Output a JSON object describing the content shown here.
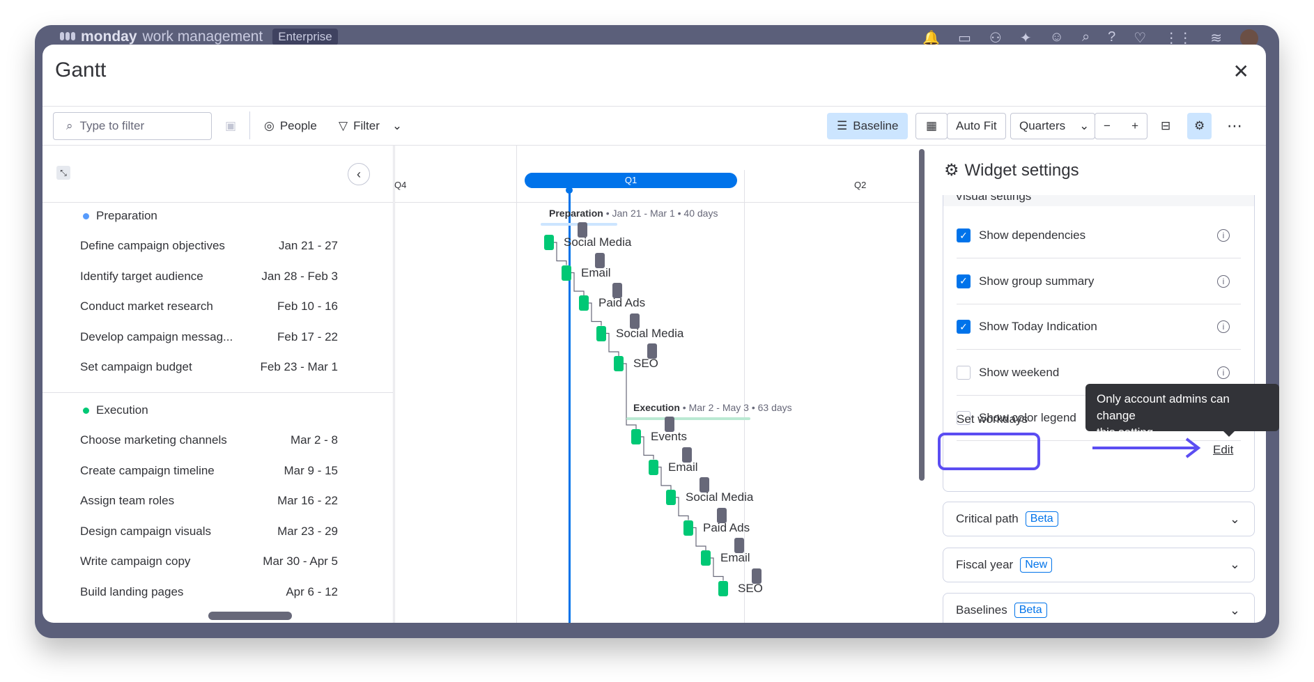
{
  "app": {
    "brand_bold": "monday",
    "brand_rest": "work management",
    "plan": "Enterprise"
  },
  "modal": {
    "title": "Gantt",
    "close": "✕"
  },
  "toolbar": {
    "filter_placeholder": "Type to filter",
    "people": "People",
    "filter": "Filter",
    "baseline": "Baseline",
    "auto_fit": "Auto Fit",
    "zoom": "Quarters"
  },
  "timeline": {
    "quarters": [
      "Q4",
      "Q1",
      "Q2"
    ]
  },
  "groups": [
    {
      "name": "Preparation",
      "color": "#579bfc",
      "summary_name": "Preparation",
      "summary_detail": " • Jan 21 - Mar 1 • 40 days",
      "tasks": [
        {
          "name": "Define campaign objectives",
          "dates": "Jan 21 - 27",
          "label": "Social Media"
        },
        {
          "name": "Identify target audience",
          "dates": "Jan 28 - Feb 3",
          "label": "Email"
        },
        {
          "name": "Conduct market research",
          "dates": "Feb 10 - 16",
          "label": "Paid Ads"
        },
        {
          "name": "Develop campaign messag...",
          "dates": "Feb 17 - 22",
          "label": "Social Media"
        },
        {
          "name": "Set campaign budget",
          "dates": "Feb 23 - Mar 1",
          "label": "SEO"
        }
      ]
    },
    {
      "name": "Execution",
      "color": "#00c875",
      "summary_name": "Execution",
      "summary_detail": " • Mar 2 - May 3 • 63 days",
      "tasks": [
        {
          "name": "Choose marketing channels",
          "dates": "Mar 2 - 8",
          "label": "Events"
        },
        {
          "name": "Create campaign timeline",
          "dates": "Mar 9 - 15",
          "label": "Email"
        },
        {
          "name": "Assign team roles",
          "dates": "Mar 16 - 22",
          "label": "Social Media"
        },
        {
          "name": "Design campaign visuals",
          "dates": "Mar 23 - 29",
          "label": "Paid Ads"
        },
        {
          "name": "Write campaign copy",
          "dates": "Mar 30 - Apr 5",
          "label": "Email"
        },
        {
          "name": "Build landing pages",
          "dates": "Apr 6 - 12",
          "label": "SEO"
        }
      ]
    }
  ],
  "settings": {
    "title": "Widget settings",
    "section": "Visual settings",
    "items": [
      {
        "label": "Show dependencies",
        "checked": true
      },
      {
        "label": "Show group summary",
        "checked": true
      },
      {
        "label": "Show Today Indication",
        "checked": true
      },
      {
        "label": "Show weekend",
        "checked": false
      },
      {
        "label": "Show color legend",
        "checked": false
      }
    ],
    "workdays_label": "Set workdays",
    "workdays_edit": "Edit",
    "accordions": [
      {
        "label": "Critical path",
        "badge": "Beta"
      },
      {
        "label": "Fiscal year",
        "badge": "New"
      },
      {
        "label": "Baselines",
        "badge": "Beta"
      }
    ]
  },
  "tooltip": {
    "line1": "Only account admins can change",
    "line2": "this setting"
  }
}
